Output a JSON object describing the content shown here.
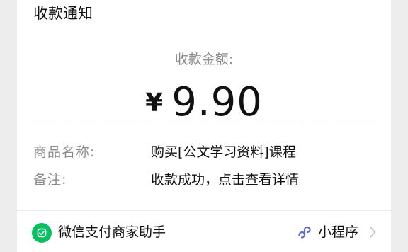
{
  "card": {
    "title": "收款通知",
    "amount_label": "收款金额:",
    "currency_symbol": "¥",
    "amount": "9.90",
    "fields": [
      {
        "key": "商品名称:",
        "value": "购买[公文学习资料]课程"
      },
      {
        "key": "备注:",
        "value": "收款成功，点击查看详情"
      }
    ]
  },
  "footer": {
    "merchant_name": "微信支付商家助手",
    "merchant_icon": "wechat-pay-merchant-icon",
    "mini_program_label": "小程序",
    "mini_program_icon": "mini-program-icon",
    "chevron_icon": "chevron-right-icon"
  },
  "colors": {
    "background": "#ededed",
    "card": "#ffffff",
    "brand_green": "#07c160",
    "mini_program_blue": "#5b6bc9",
    "secondary_text": "#8c8c8c",
    "primary_text": "#111111"
  }
}
